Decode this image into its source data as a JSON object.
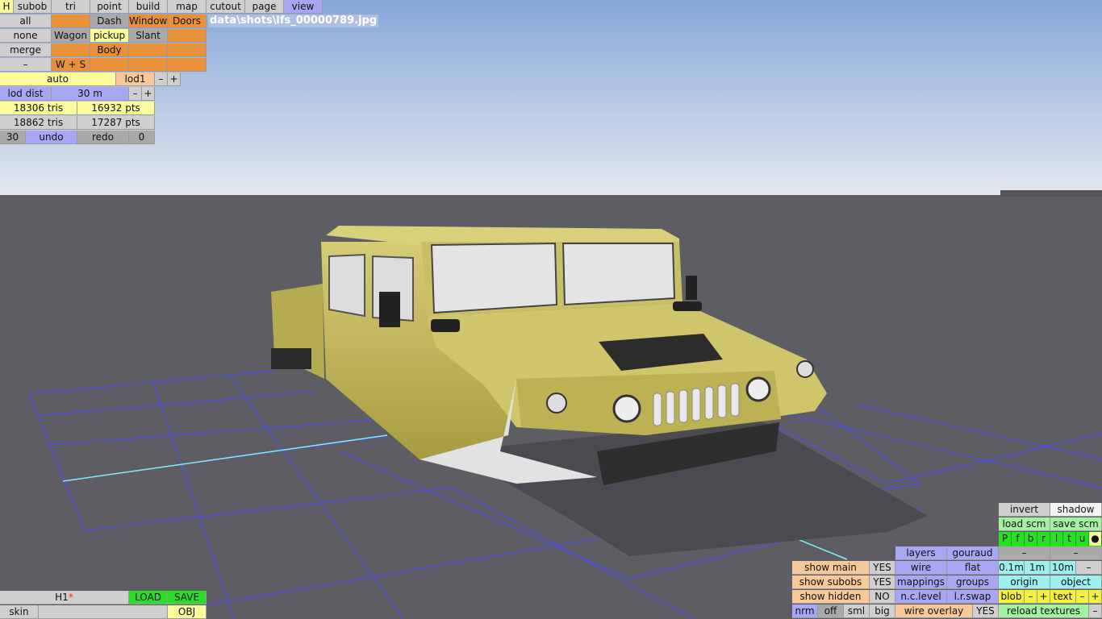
{
  "file_path": "data\\shots\\lfs_00000789.jpg",
  "menu": {
    "h": "H",
    "subob": "subob",
    "tri": "tri",
    "point": "point",
    "build": "build",
    "map": "map",
    "cutout": "cutout",
    "page": "page",
    "view": "view"
  },
  "subobjects": {
    "all": "all",
    "none": "none",
    "merge": "merge",
    "minus": "–",
    "dash": "Dash",
    "windows": "Windows",
    "doors": "Doors",
    "wagon": "Wagon",
    "pickup": "pickup",
    "slant": "Slant",
    "body": "Body",
    "ws": "W + S"
  },
  "lod": {
    "auto": "auto",
    "lod1": "lod1",
    "minus": "–",
    "plus": "+",
    "lod_dist_label": "lod dist",
    "lod_dist_value": "30 m"
  },
  "stats": {
    "tris1": "18306 tris",
    "pts1": "16932 pts",
    "tris2": "18862 tris",
    "pts2": "17287 pts"
  },
  "undo": {
    "count": "30",
    "undo": "undo",
    "redo": "redo",
    "redo_count": "0"
  },
  "bottom_left": {
    "name": "H1",
    "star": "*",
    "load": "LOAD",
    "save": "SAVE",
    "skin": "skin",
    "obj": "OBJ"
  },
  "bottom_right": {
    "invert": "invert",
    "shadow": "shadow",
    "load_scm": "load scm",
    "save_scm": "save scm",
    "letters": [
      "P",
      "f",
      "b",
      "r",
      "l",
      "t",
      "u",
      "●"
    ],
    "layers": "layers",
    "gouraud": "gouraud",
    "dash1": "–",
    "dash2": "–",
    "show_main": "show main",
    "show_main_val": "YES",
    "wire": "wire",
    "flat": "flat",
    "d01": "0.1m",
    "d1": "1m",
    "d10": "10m",
    "dminus": "–",
    "show_subobs": "show subobs",
    "show_subobs_val": "YES",
    "mappings": "mappings",
    "groups": "groups",
    "origin": "origin",
    "object": "object",
    "show_hidden": "show hidden",
    "show_hidden_val": "NO",
    "nc_level": "n.c.level",
    "lr_swap": "l.r.swap",
    "blob": "blob",
    "blob_minus": "–",
    "blob_plus": "+",
    "text": "text",
    "text_minus": "–",
    "text_plus": "+",
    "nrm": "nrm",
    "off": "off",
    "sml": "sml",
    "big": "big",
    "wire_overlay": "wire overlay",
    "wire_overlay_val": "YES",
    "reload_textures": "reload textures",
    "reload_minus": "–"
  },
  "colors": {
    "sky_top": "#86a6d8",
    "sky_bottom": "#dfe6ee",
    "ground": "#5d5d63",
    "grid": "#5050f0",
    "grid_highlight": "#80f0f0",
    "vehicle": "#c4ba5e"
  }
}
